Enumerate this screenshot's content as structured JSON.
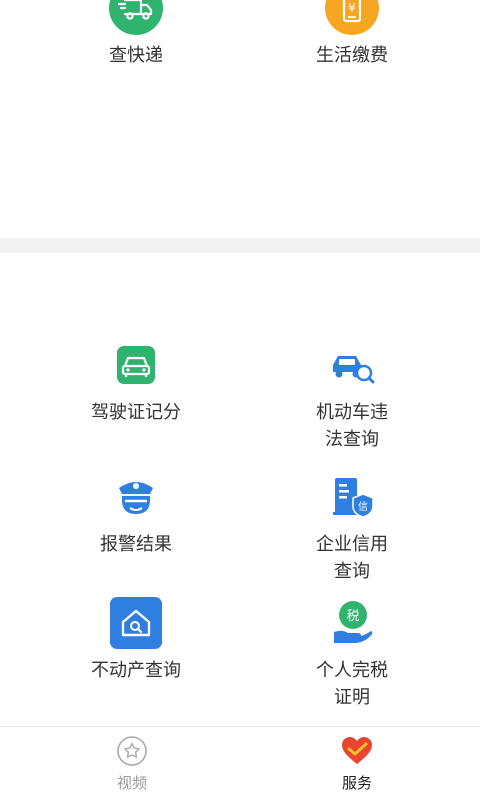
{
  "top_services": [
    {
      "label": "查快递",
      "icon": "delivery-truck-icon",
      "color": "#2fb36f"
    },
    {
      "label": "生活缴费",
      "icon": "bill-payment-icon",
      "color": "#f6a623"
    }
  ],
  "services": [
    {
      "label": "驾驶证记分",
      "icon": "car-front-icon",
      "color": "#2fb36f"
    },
    {
      "label": "机动车违法查询",
      "line1": "机动车违",
      "line2": "法查询",
      "icon": "car-search-icon",
      "color": "#2f7fe0"
    },
    {
      "label": "报警结果",
      "icon": "police-icon",
      "color": "#2f7fe0"
    },
    {
      "label": "企业信用查询",
      "line1": "企业信用",
      "line2": "查询",
      "icon": "enterprise-credit-icon",
      "color": "#2f7fe0"
    },
    {
      "label": "不动产查询",
      "icon": "house-search-icon",
      "color": "#2f7fe0"
    },
    {
      "label": "个人完税证明",
      "line1": "个人完税",
      "line2": "证明",
      "icon": "tax-certificate-icon",
      "color": "#2fb36f"
    }
  ],
  "tabbar": {
    "video": {
      "label": "视频",
      "icon": "star-icon"
    },
    "service": {
      "label": "服务",
      "icon": "heart-check-icon",
      "color": "#e8442f"
    }
  }
}
